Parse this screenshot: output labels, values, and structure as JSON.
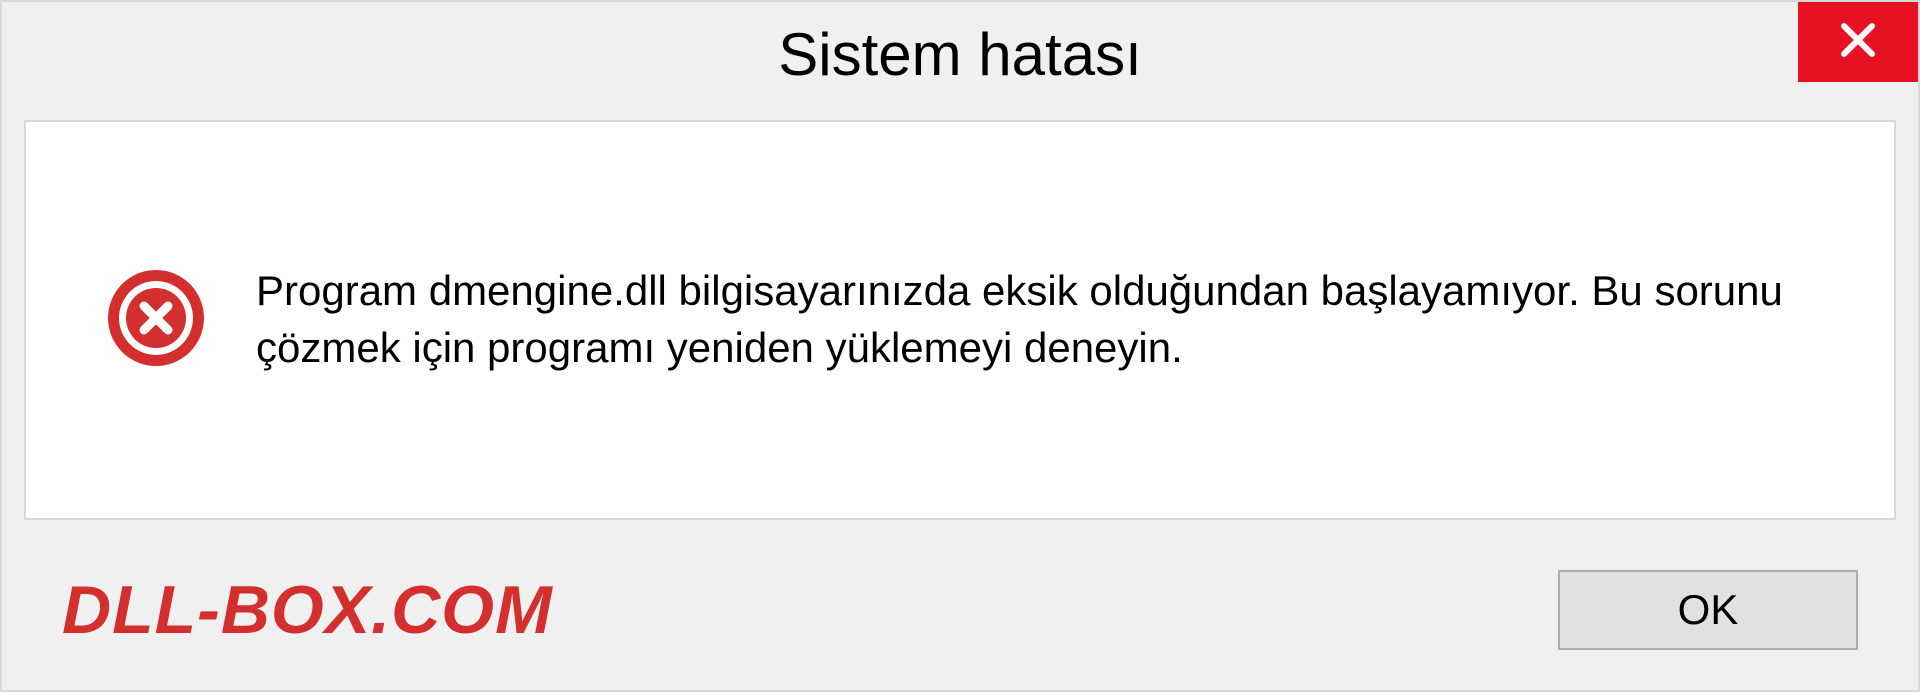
{
  "dialog": {
    "title": "Sistem hatası",
    "message": "Program dmengine.dll bilgisayarınızda eksik olduğundan başlayamıyor. Bu sorunu çözmek için programı yeniden yüklemeyi deneyin.",
    "ok_label": "OK"
  },
  "watermark": "DLL-BOX.COM"
}
